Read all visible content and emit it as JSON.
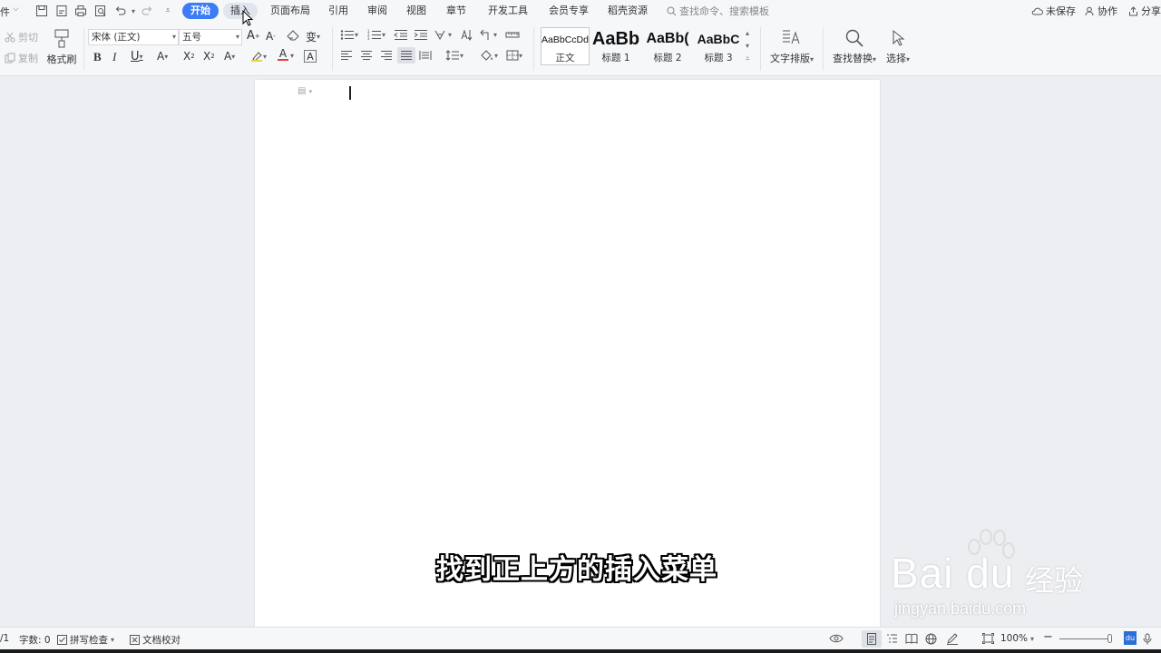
{
  "menubar": {
    "file_label": "件",
    "tabs": [
      {
        "label": "开始",
        "state": "active"
      },
      {
        "label": "插入",
        "state": "hover"
      },
      {
        "label": "页面布局"
      },
      {
        "label": "引用"
      },
      {
        "label": "审阅"
      },
      {
        "label": "视图"
      },
      {
        "label": "章节"
      },
      {
        "label": "开发工具"
      },
      {
        "label": "会员专享"
      },
      {
        "label": "稻壳资源"
      }
    ],
    "search_placeholder": "查找命令、搜索模板",
    "unsaved_label": "未保存",
    "collab_label": "协作",
    "share_label": "分享",
    "accent_color": "#3c7cf6"
  },
  "ribbon": {
    "cut_label": "剪切",
    "copy_label": "复制",
    "format_painter_label": "格式刷",
    "font_name": "宋体 (正文)",
    "font_size": "五号",
    "styles": [
      {
        "preview": "AaBbCcDd",
        "label": "正文"
      },
      {
        "preview": "AaBb",
        "label": "标题 1"
      },
      {
        "preview": "AaBb(",
        "label": "标题 2"
      },
      {
        "preview": "AaBbC",
        "label": "标题 3"
      }
    ],
    "text_layout_label": "文字排版",
    "find_replace_label": "查找替换",
    "select_label": "选择"
  },
  "document": {
    "subtitle": "找到正上方的插入菜单"
  },
  "watermark": {
    "brand": "Bai du",
    "suffix": "经验",
    "url": "jingyan.baidu.com"
  },
  "statusbar": {
    "page_fragment": "/1",
    "word_count": "字数: 0",
    "spell_check": "拼写检查",
    "doc_proof": "文档校对",
    "zoom": "100%"
  }
}
